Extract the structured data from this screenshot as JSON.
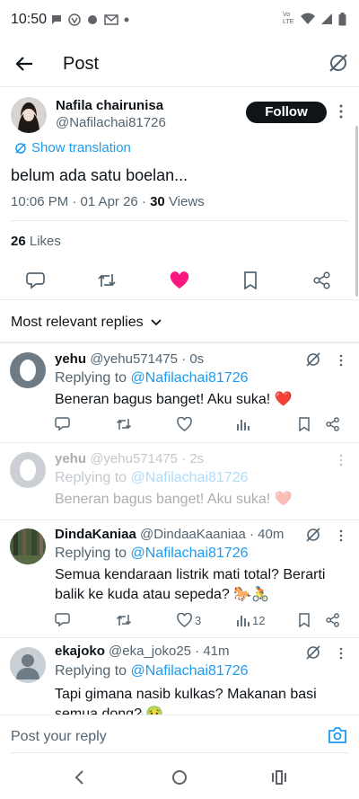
{
  "status_bar": {
    "time": "10:50",
    "network": "Vo LTE"
  },
  "app_bar": {
    "title": "Post"
  },
  "post": {
    "author_name": "Nafila chairunisa",
    "author_handle": "@Nafilachai81726",
    "follow_label": "Follow",
    "translation_label": "Show translation",
    "text": "belum ada satu boelan...",
    "timestamp": "10:06 PM · 01 Apr 26 · ",
    "views_count": "30",
    "views_label": " Views",
    "likes_count": "26",
    "likes_label": " Likes"
  },
  "replies_sort": {
    "label": "Most relevant replies"
  },
  "replies": [
    {
      "name": "yehu",
      "handle": "@yehu571475 · 0s",
      "replying_prefix": "Replying to ",
      "replying_to": "@Nafilachai81726",
      "text": "Beneran bagus banget! Aku suka! ❤️",
      "likes": "",
      "views": ""
    },
    {
      "name": "yehu",
      "handle": "@yehu571475 · 2s",
      "replying_prefix": "Replying to ",
      "replying_to": "@Nafilachai81726",
      "text": "Beneran bagus banget! Aku suka! ❤️"
    },
    {
      "name": "DindaKaniaa",
      "handle": "@DindaaKaaniaa · 40m",
      "replying_prefix": "Replying to ",
      "replying_to": "@Nafilachai81726",
      "text_line1": "Semua kendaraan listrik mati total? Berarti",
      "text_line2": "balik ke kuda atau sepeda? 🐎🚴",
      "likes": "3",
      "views": "12"
    },
    {
      "name": "ekajoko",
      "handle": "@eka_joko25 · 41m",
      "replying_prefix": "Replying to ",
      "replying_to": "@Nafilachai81726",
      "text_line1": "Tapi gimana nasib kulkas? Makanan basi",
      "text_line2": "semua dong? 🤢"
    }
  ],
  "reply_composer": {
    "placeholder": "Post your reply"
  },
  "colors": {
    "accent": "#1d9bf0",
    "like": "#f91880",
    "text": "#0f1419",
    "secondary": "#536471"
  }
}
